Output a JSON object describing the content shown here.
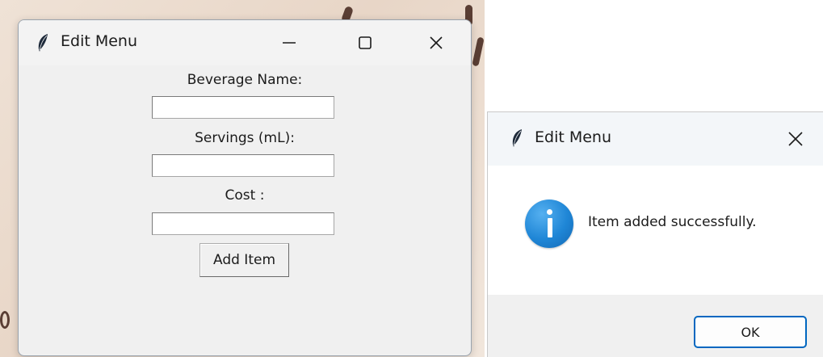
{
  "edit_window": {
    "title": "Edit Menu",
    "controls": {
      "minimize": "—",
      "maximize": "☐",
      "close": "✕"
    },
    "form": {
      "beverage_name_label": "Beverage Name:",
      "beverage_name_value": "",
      "servings_label": "Servings (mL):",
      "servings_value": "",
      "cost_label": "Cost :",
      "cost_value": "",
      "add_button_label": "Add Item"
    }
  },
  "message_dialog": {
    "title": "Edit Menu",
    "close": "✕",
    "icon": "info-icon",
    "message": "Item added successfully.",
    "ok_label": "OK"
  },
  "colors": {
    "accent": "#0067c0",
    "info_icon": "#1f86d6",
    "window_bg": "#f0f0f0"
  }
}
